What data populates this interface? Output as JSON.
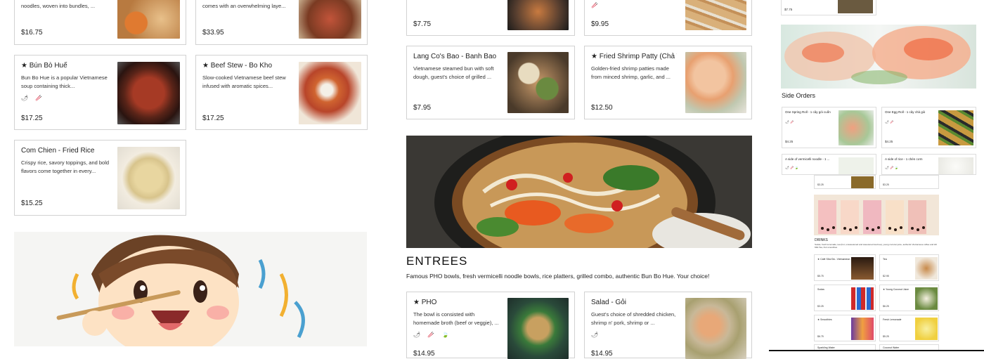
{
  "left_column": {
    "top_cards": [
      {
        "desc": "noodles, woven into bundles, ...",
        "price": "$16.75"
      },
      {
        "desc": "comes with an overwhelming laye...",
        "price": "$33.95"
      }
    ],
    "cards": [
      {
        "title": "★ Bún Bò Huế",
        "desc": "Bun Bo Hue is a popular Vietnamese soup containing thick...",
        "price": "$17.25",
        "icons": "🌶 🥢"
      },
      {
        "title": "★ Beef Stew - Bo Kho",
        "desc": "Slow-cooked Vietnamese beef stew infused with aromatic spices...",
        "price": "$17.25"
      },
      {
        "title": "Com Chien - Fried Rice",
        "desc": "Crispy rice, savory toppings, and bold flavors come together in every...",
        "price": "$15.25"
      }
    ]
  },
  "middle_column": {
    "top_cards": [
      {
        "price": "$7.75"
      },
      {
        "price": "$9.95",
        "icons": "🥢"
      }
    ],
    "cards": [
      {
        "title": "Lang Co's Bao - Banh Bao",
        "desc": "Vietnamese steamed bun with soft dough, guest's choice of grilled ...",
        "price": "$7.95"
      },
      {
        "title": "★ Fried Shrimp Patty (Chả Tôm)",
        "desc": "Golden-fried shrimp patties made from minced shrimp, garlic, and ...",
        "price": "$12.50"
      }
    ],
    "entrees": {
      "title": "ENTREES",
      "description": "Famous PHO bowls, fresh vermicelli noodle bowls, rice platters, grilled combo, authentic Bun Bo Hue. Your choice!"
    },
    "entree_cards": [
      {
        "title": "★ PHO",
        "desc": "The bowl is consisted with homemade broth (beef or veggie), ...",
        "icons": "🌶 🥢 🍃",
        "price": "$14.95"
      },
      {
        "title": "Salad - Gỏi",
        "desc": "Guest's choice of shredded chicken, shrimp n' pork, shrimp or ...",
        "icons": "🌶",
        "price": "$14.95"
      }
    ]
  },
  "right_column": {
    "top_price": "$7.75",
    "side_orders_label": "Side Orders",
    "side_cards": [
      {
        "title": "One Spring Roll - 1 cây gỏi cuốn",
        "price": "$4.25"
      },
      {
        "title": "One Egg Roll - 1 cây chả giò",
        "price": "$4.25"
      },
      {
        "title": "A side of vermicelli noodle - 1 ...",
        "price": "$3.25"
      },
      {
        "title": "A side of rice - 1 chén cơm",
        "price": "$3.25"
      }
    ],
    "drinks_label": "DRINKS",
    "drinks_desc": "Sodas, fresh lemonade, tea (hot, unsweetened and sweetened iced tea), young coconut juice, authentic Vietnamese coffee and HK Milk Tea, fruit smoothies",
    "drink_cards": [
      {
        "title": "★ Café Sữa Đá - Vietnamese...",
        "price": "$5.75"
      },
      {
        "title": "Tea",
        "price": "$2.95"
      },
      {
        "title": "Sodas",
        "price": "$3.25"
      },
      {
        "title": "★ Young Coconut Juice",
        "price": "$6.25"
      },
      {
        "title": "★ Smoothies",
        "price": "$6.75"
      },
      {
        "title": "Fresh Lemonade",
        "price": "$5.25"
      },
      {
        "title": "Sparkling Water",
        "price": ""
      },
      {
        "title": "Coconut Water",
        "price": ""
      }
    ]
  }
}
